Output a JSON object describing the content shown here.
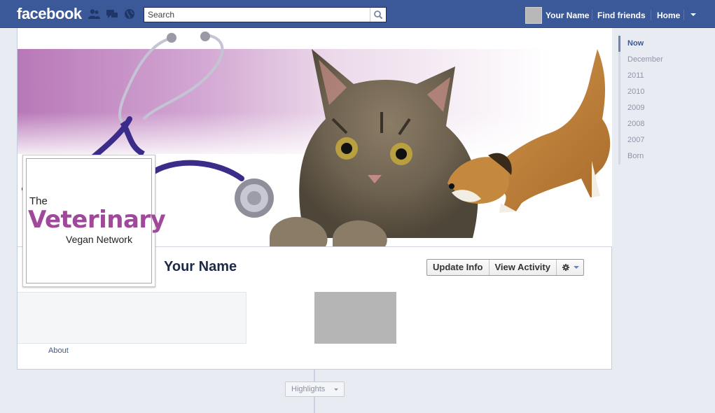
{
  "topbar": {
    "logo": "facebook",
    "search": {
      "placeholder": "Search",
      "value": ""
    },
    "user_name": "Your Name",
    "find_friends": "Find friends",
    "home": "Home"
  },
  "profile": {
    "name": "Your Name",
    "profile_logo": {
      "line1": "The",
      "line2": "Veterinary",
      "line3": "Vegan Network"
    },
    "buttons": {
      "update_info": "Update Info",
      "view_activity": "View Activity"
    },
    "about_link": "About"
  },
  "timeline": {
    "highlights": "Highlights",
    "scrubber": [
      "Now",
      "December",
      "2011",
      "2010",
      "2009",
      "2008",
      "2007",
      "Born"
    ]
  },
  "colors": {
    "brand_blue": "#3b5998",
    "logo_purple": "#a0489a"
  }
}
